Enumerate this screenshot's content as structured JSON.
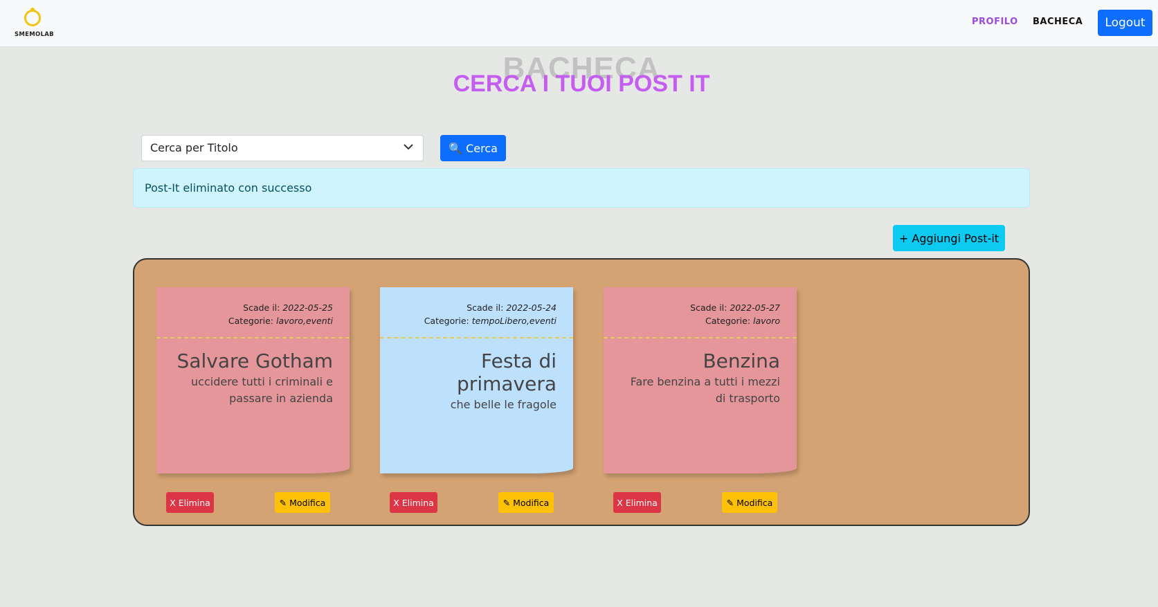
{
  "brand": {
    "name": "SMEMOLAB"
  },
  "nav": {
    "profilo": "PROFILO",
    "bacheca": "BACHECA",
    "logout": "Logout"
  },
  "titles": {
    "back": "BACHECA",
    "front": "CERCA I TUOI POST IT"
  },
  "search": {
    "select_value": "Cerca per Titolo",
    "button": "🔍 Cerca"
  },
  "alert": {
    "message": "Post-It eliminato con successo"
  },
  "add_button": "+ Aggiungi Post-it",
  "notes": [
    {
      "due_label": "Scade il: ",
      "due": "2022-05-25",
      "cat_label": "Categorie: ",
      "categories": "lavoro,eventi",
      "title": "Salvare Gotham",
      "desc": "uccidere tutti i criminali e passare in azienda",
      "color": "#e4969a"
    },
    {
      "due_label": "Scade il: ",
      "due": "2022-05-24",
      "cat_label": "Categorie: ",
      "categories": "tempoLibero,eventi",
      "title": "Festa di primavera",
      "desc": "che belle le fragole",
      "color": "#bde0fd"
    },
    {
      "due_label": "Scade il: ",
      "due": "2022-05-27",
      "cat_label": "Categorie: ",
      "categories": "lavoro",
      "title": "Benzina",
      "desc": "Fare benzina a tutti i mezzi di trasporto",
      "color": "#e4969a"
    }
  ],
  "actions": {
    "delete": "X Elimina",
    "edit": "✎ Modifica"
  },
  "colors": {
    "board": "#d4a373",
    "primary": "#0d6efd",
    "info": "#0dcaf0",
    "danger": "#dc3545",
    "warning": "#ffc107",
    "accent": "#c55df0"
  }
}
